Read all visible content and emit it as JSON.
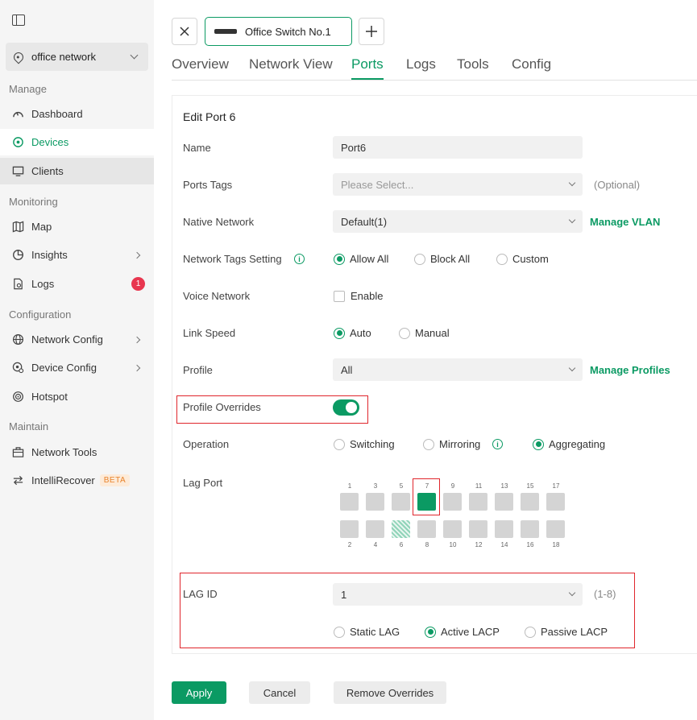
{
  "sidebar": {
    "site": "office network",
    "sections": {
      "manage": "Manage",
      "monitoring": "Monitoring",
      "configuration": "Configuration",
      "maintain": "Maintain"
    },
    "items": {
      "dashboard": "Dashboard",
      "devices": "Devices",
      "clients": "Clients",
      "map": "Map",
      "insights": "Insights",
      "logs": "Logs",
      "logs_badge": "1",
      "network_config": "Network Config",
      "device_config": "Device Config",
      "hotspot": "Hotspot",
      "network_tools": "Network Tools",
      "intellirecover": "IntelliRecover",
      "beta": "BETA"
    }
  },
  "device_tab": "Office Switch No.1",
  "tabs": [
    "Overview",
    "Network View",
    "Ports",
    "Logs",
    "Tools",
    "Config"
  ],
  "active_tab": "Ports",
  "form": {
    "title": "Edit Port 6",
    "name_label": "Name",
    "name_value": "Port6",
    "ports_tags_label": "Ports Tags",
    "ports_tags_placeholder": "Please Select...",
    "optional": "(Optional)",
    "native_network_label": "Native Network",
    "native_network_value": "Default(1)",
    "manage_vlan": "Manage VLAN",
    "network_tags_label": "Network Tags Setting",
    "network_tags_options": [
      "Allow All",
      "Block All",
      "Custom"
    ],
    "network_tags_selected": "Allow All",
    "voice_network_label": "Voice Network",
    "voice_enable": "Enable",
    "link_speed_label": "Link Speed",
    "link_speed_options": [
      "Auto",
      "Manual"
    ],
    "link_speed_selected": "Auto",
    "profile_label": "Profile",
    "profile_value": "All",
    "manage_profiles": "Manage Profiles",
    "profile_overrides_label": "Profile Overrides",
    "profile_overrides_on": true,
    "operation_label": "Operation",
    "operation_options": [
      "Switching",
      "Mirroring",
      "Aggregating"
    ],
    "operation_selected": "Aggregating",
    "lag_port_label": "Lag Port",
    "ports_top": [
      "1",
      "3",
      "5",
      "7",
      "9",
      "11",
      "13",
      "15",
      "17"
    ],
    "ports_bottom": [
      "2",
      "4",
      "6",
      "8",
      "10",
      "12",
      "14",
      "16",
      "18"
    ],
    "selected_port": "7",
    "current_port": "6",
    "lag_id_label": "LAG ID",
    "lag_id_value": "1",
    "lag_id_range": "(1-8)",
    "lag_mode_options": [
      "Static LAG",
      "Active LACP",
      "Passive LACP"
    ],
    "lag_mode_selected": "Active LACP"
  },
  "buttons": {
    "apply": "Apply",
    "cancel": "Cancel",
    "remove_overrides": "Remove Overrides"
  },
  "colors": {
    "accent": "#0b9a63",
    "highlight_box": "#e0262c",
    "badge": "#e8364f"
  }
}
